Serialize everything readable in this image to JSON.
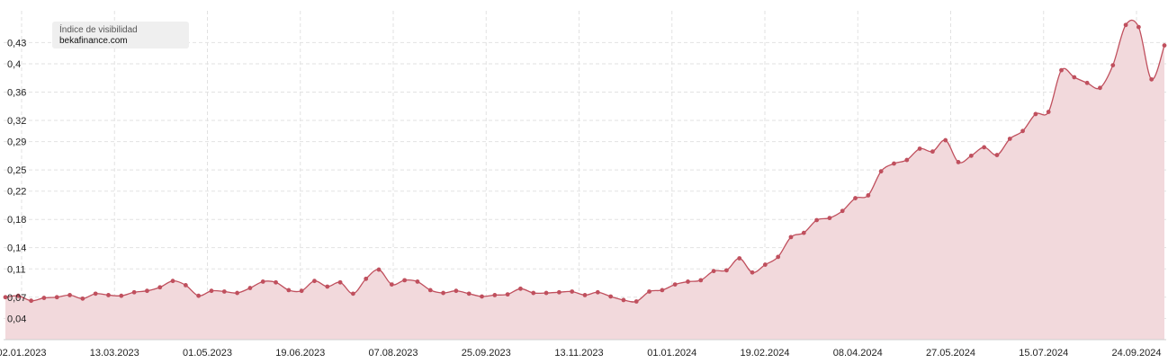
{
  "legend": {
    "title": "Índice de visibilidad",
    "domain": "bekafinance.com"
  },
  "colors": {
    "line": "#c0505e",
    "area": "#f2d9dc",
    "grid": "#e2e2e2",
    "legend_bg": "#efefef"
  },
  "chart_data": {
    "type": "area",
    "title": "",
    "xlabel": "",
    "ylabel": "",
    "grid": true,
    "legend_placement": "top-left",
    "ylim": [
      0.01,
      0.475
    ],
    "y_ticks": [
      0.04,
      0.07,
      0.11,
      0.14,
      0.18,
      0.22,
      0.25,
      0.29,
      0.32,
      0.36,
      0.4,
      0.43
    ],
    "y_tick_labels": [
      "0,04",
      "0,07",
      "0,11",
      "0,14",
      "0,18",
      "0,22",
      "0,25",
      "0,29",
      "0,32",
      "0,36",
      "0,4",
      "0,43"
    ],
    "x_tick_labels": [
      "02.01.2023",
      "13.03.2023",
      "01.05.2023",
      "19.06.2023",
      "07.08.2023",
      "25.09.2023",
      "13.11.2023",
      "01.01.2024",
      "19.02.2024",
      "08.04.2024",
      "27.05.2024",
      "15.07.2024",
      "24.09.2024"
    ],
    "series": [
      {
        "values": [
          0.07,
          0.072,
          0.065,
          0.069,
          0.07,
          0.073,
          0.068,
          0.075,
          0.073,
          0.072,
          0.077,
          0.079,
          0.084,
          0.093,
          0.087,
          0.072,
          0.079,
          0.078,
          0.076,
          0.083,
          0.092,
          0.091,
          0.08,
          0.079,
          0.093,
          0.085,
          0.091,
          0.075,
          0.096,
          0.109,
          0.088,
          0.094,
          0.092,
          0.08,
          0.076,
          0.079,
          0.075,
          0.071,
          0.073,
          0.074,
          0.082,
          0.076,
          0.076,
          0.077,
          0.078,
          0.073,
          0.077,
          0.071,
          0.066,
          0.064,
          0.078,
          0.08,
          0.088,
          0.092,
          0.094,
          0.107,
          0.108,
          0.125,
          0.105,
          0.116,
          0.127,
          0.155,
          0.161,
          0.179,
          0.182,
          0.192,
          0.21,
          0.214,
          0.248,
          0.259,
          0.264,
          0.28,
          0.276,
          0.292,
          0.261,
          0.27,
          0.282,
          0.271,
          0.294,
          0.305,
          0.329,
          0.332,
          0.391,
          0.381,
          0.373,
          0.366,
          0.398,
          0.455,
          0.452,
          0.378,
          0.426
        ]
      }
    ]
  }
}
